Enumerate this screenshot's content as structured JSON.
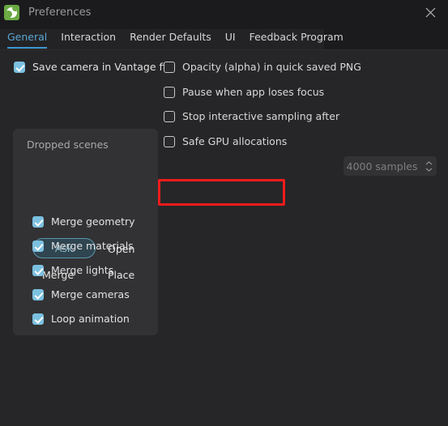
{
  "window": {
    "title": "Preferences",
    "app_icon": "vantage-globe-icon",
    "close_icon": "close-icon",
    "background_color": "#262628",
    "accent_color": "#3e96cf",
    "annotation_color": "#f21b1b"
  },
  "tabs": [
    {
      "label": "General",
      "active": true
    },
    {
      "label": "Interaction",
      "active": false
    },
    {
      "label": "Render Defaults",
      "active": false
    },
    {
      "label": "UI",
      "active": false
    },
    {
      "label": "Feedback Program",
      "active": false
    }
  ],
  "left_column": {
    "save_camera": {
      "label": "Save camera in Vantage file",
      "checked": true
    },
    "group": {
      "title": "Dropped scenes",
      "options": [
        {
          "label": "Ask",
          "selected": true
        },
        {
          "label": "Open",
          "selected": false
        },
        {
          "label": "Merge",
          "selected": false
        },
        {
          "label": "Place",
          "selected": false
        }
      ],
      "checkboxes": [
        {
          "label": "Merge geometry",
          "checked": true
        },
        {
          "label": "Merge materials",
          "checked": true
        },
        {
          "label": "Merge lights",
          "checked": true
        },
        {
          "label": "Merge cameras",
          "checked": true
        },
        {
          "label": "Loop animation",
          "checked": true
        }
      ]
    }
  },
  "right_column": {
    "checkboxes": [
      {
        "label": "Opacity (alpha) in quick saved PNG",
        "checked": false
      },
      {
        "label": "Pause when app loses focus",
        "checked": false
      },
      {
        "label": "Stop interactive sampling after",
        "checked": false
      },
      {
        "label": "Safe GPU allocations",
        "checked": false
      }
    ],
    "samples_spinner": {
      "value": "4000 samples",
      "enabled": false
    }
  }
}
